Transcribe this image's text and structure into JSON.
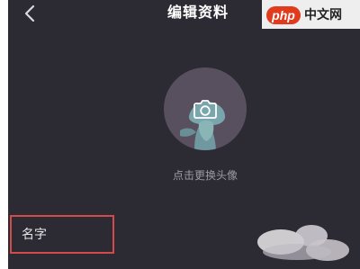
{
  "header": {
    "title": "编辑资料"
  },
  "avatar": {
    "hint": "点击更换头像"
  },
  "form": {
    "name_label": "名字"
  },
  "watermark": {
    "brand": "php",
    "text": "中文网"
  },
  "colors": {
    "background": "#2c2b33",
    "highlight_border": "#d24a4a",
    "brand": "#e23a1d"
  },
  "icons": {
    "back": "chevron-left-icon",
    "avatar_action": "camera-icon"
  }
}
